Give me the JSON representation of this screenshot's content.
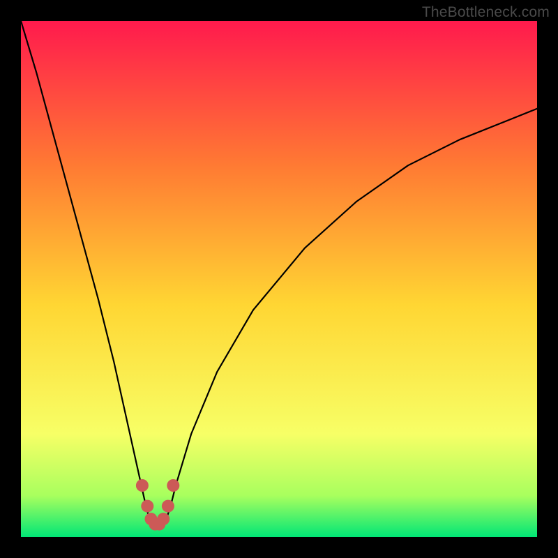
{
  "watermark": "TheBottleneck.com",
  "colors": {
    "bg_black": "#000000",
    "grad_top": "#ff1a4d",
    "grad_mid_upper": "#ff7a33",
    "grad_mid": "#ffd633",
    "grad_lower_yellow": "#f7ff66",
    "grad_green_top": "#a8ff5e",
    "grad_green_bottom": "#00e676",
    "curve": "#000000",
    "marker": "#cc5a57"
  },
  "chart_data": {
    "type": "line",
    "title": "",
    "xlabel": "",
    "ylabel": "",
    "xlim": [
      0,
      100
    ],
    "ylim": [
      0,
      100
    ],
    "series": [
      {
        "name": "bottleneck-curve",
        "x": [
          0,
          3,
          6,
          9,
          12,
          15,
          18,
          20,
          22,
          24,
          25,
          26,
          27,
          28,
          29,
          30,
          33,
          38,
          45,
          55,
          65,
          75,
          85,
          95,
          100
        ],
        "y": [
          100,
          90,
          79,
          68,
          57,
          46,
          34,
          25,
          16,
          7,
          3,
          2,
          2,
          3,
          6,
          10,
          20,
          32,
          44,
          56,
          65,
          72,
          77,
          81,
          83
        ]
      }
    ],
    "markers": {
      "name": "highlight-min",
      "x": [
        23.5,
        24.5,
        25.2,
        26,
        26.8,
        27.6,
        28.5,
        29.5
      ],
      "y": [
        10,
        6,
        3.5,
        2.5,
        2.5,
        3.5,
        6,
        10
      ]
    }
  }
}
